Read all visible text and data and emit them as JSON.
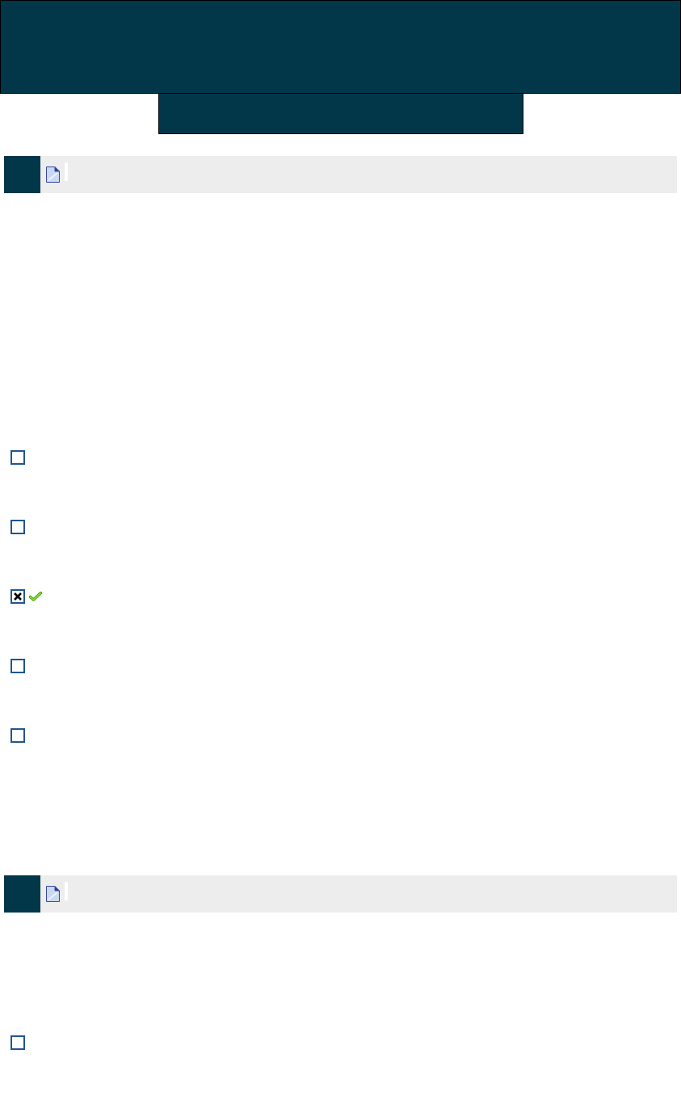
{
  "questions": [
    {
      "options": [
        {
          "checked": false,
          "marked_correct": false
        },
        {
          "checked": false,
          "marked_correct": false
        },
        {
          "checked": true,
          "marked_correct": true
        },
        {
          "checked": false,
          "marked_correct": false
        },
        {
          "checked": false,
          "marked_correct": false
        }
      ]
    },
    {
      "options": [
        {
          "checked": false,
          "marked_correct": false
        }
      ]
    }
  ]
}
